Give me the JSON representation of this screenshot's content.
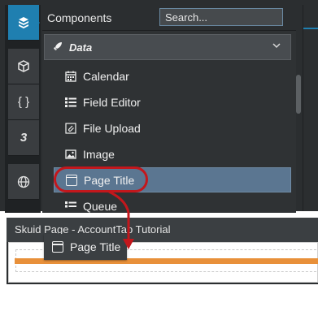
{
  "sidebar": {
    "items": [
      {
        "icon": "cube-stack-icon",
        "glyph": "❒",
        "active": true
      },
      {
        "icon": "cube-icon",
        "glyph": "⬢",
        "active": false
      },
      {
        "icon": "braces-icon",
        "glyph": "{ }",
        "active": false
      },
      {
        "icon": "css3-icon",
        "glyph": "3",
        "active": false
      },
      {
        "icon": "globe-icon",
        "glyph": "⊕",
        "active": false
      }
    ]
  },
  "panel": {
    "title": "Components",
    "search_placeholder": "Search...",
    "group": {
      "label": "Data",
      "icon": "rocket-icon",
      "expanded_icon": "chevron-down-icon"
    },
    "items": [
      {
        "label": "Calendar",
        "icon": "calendar-icon"
      },
      {
        "label": "Field Editor",
        "icon": "list-icon"
      },
      {
        "label": "File Upload",
        "icon": "paperclip-icon"
      },
      {
        "label": "Image",
        "icon": "image-icon"
      },
      {
        "label": "Page Title",
        "icon": "window-icon",
        "selected": true
      },
      {
        "label": "Queue",
        "icon": "queue-icon"
      }
    ]
  },
  "page": {
    "title": "Skuid Page - AccountTab Tutorial"
  },
  "drag_ghost": {
    "label": "Page Title",
    "icon": "window-icon"
  },
  "colors": {
    "accent": "#1f7fb0",
    "selected": "#5b7691",
    "callout": "#c3171c",
    "orange_bar": "#e8903a"
  }
}
